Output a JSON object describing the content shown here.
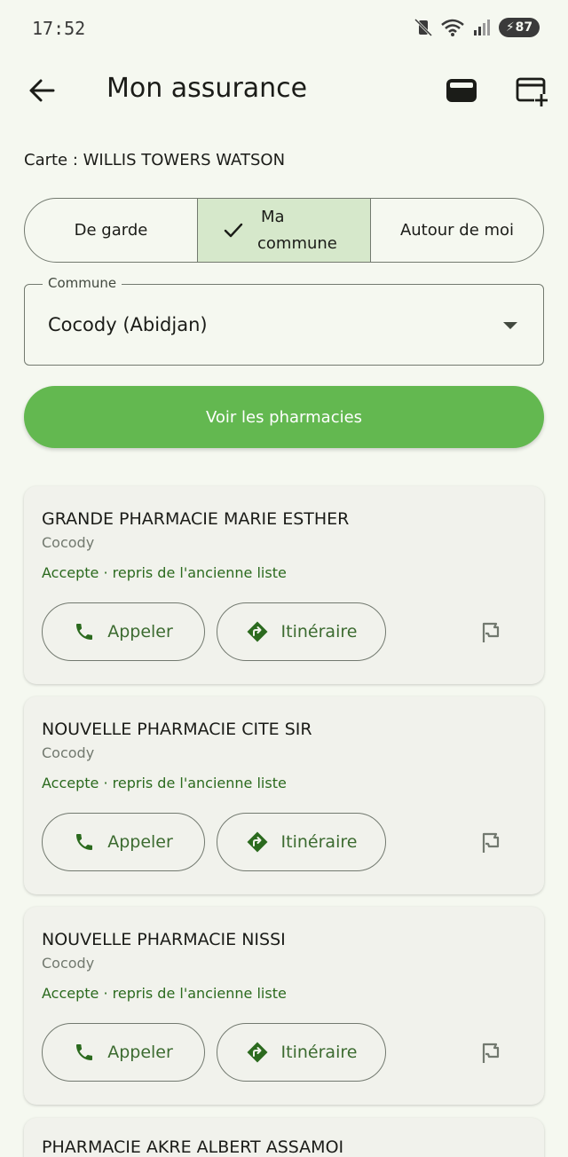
{
  "status_bar": {
    "time": "17:52",
    "battery": "87",
    "icons": [
      "vibrate-mute-icon",
      "wifi-icon",
      "signal-icon",
      "battery-charging-icon"
    ]
  },
  "app_bar": {
    "title": "Mon assurance",
    "icons": [
      "back-arrow-icon",
      "wallet-icon",
      "add-card-icon"
    ]
  },
  "card_label": "Carte : WILLIS TOWERS WATSON",
  "segments": {
    "de_garde": "De garde",
    "ma_commune_line1": "Ma",
    "ma_commune_line2": "commune",
    "autour": "Autour de moi",
    "selected": "Ma commune"
  },
  "commune_field": {
    "label": "Commune",
    "value": "Cocody (Abidjan)"
  },
  "primary_button": "Voir les pharmacies",
  "actions": {
    "call": "Appeler",
    "route": "Itinéraire"
  },
  "pharmacies": [
    {
      "name": "GRANDE PHARMACIE MARIE ESTHER",
      "commune": "Cocody",
      "status": "Accepte · repris de l'ancienne liste"
    },
    {
      "name": "NOUVELLE PHARMACIE CITE SIR",
      "commune": "Cocody",
      "status": "Accepte · repris de l'ancienne liste"
    },
    {
      "name": "NOUVELLE PHARMACIE NISSI",
      "commune": "Cocody",
      "status": "Accepte · repris de l'ancienne liste"
    },
    {
      "name": "PHARMACIE AKRE ALBERT ASSAMOI"
    }
  ],
  "colors": {
    "primary": "#63b850",
    "selected_segment": "#d6e8cb",
    "status_text": "#2b6a1e",
    "background": "#f5f8f0"
  }
}
